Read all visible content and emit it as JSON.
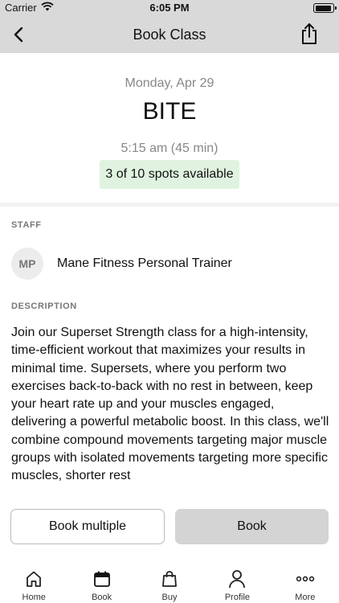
{
  "status_bar": {
    "carrier": "Carrier",
    "time": "6:05 PM"
  },
  "nav": {
    "title": "Book Class"
  },
  "class_info": {
    "date": "Monday, Apr 29",
    "name": "BITE",
    "time": "5:15 am (45 min)",
    "spots": "3 of 10 spots available"
  },
  "staff": {
    "label": "STAFF",
    "initials": "MP",
    "name": "Mane Fitness Personal Trainer"
  },
  "description": {
    "label": "DESCRIPTION",
    "text": "Join our Superset Strength class for a high-intensity, time-efficient workout that maximizes your results in minimal time. Supersets, where you perform two exercises back-to-back with no rest in between, keep your heart rate up and your muscles engaged, delivering a powerful metabolic boost. In this class, we'll combine compound movements targeting major muscle groups with isolated movements targeting more specific muscles, shorter rest"
  },
  "actions": {
    "book_multiple": "Book multiple",
    "book": "Book"
  },
  "tabs": [
    {
      "label": "Home",
      "icon": "home-icon"
    },
    {
      "label": "Book",
      "icon": "calendar-icon"
    },
    {
      "label": "Buy",
      "icon": "shopping-bag-icon"
    },
    {
      "label": "Profile",
      "icon": "person-icon"
    },
    {
      "label": "More",
      "icon": "more-icon"
    }
  ],
  "colors": {
    "nav_background": "#d9d9d9",
    "spots_badge": "#e0f3e0",
    "book_button": "#d4d4d4"
  }
}
